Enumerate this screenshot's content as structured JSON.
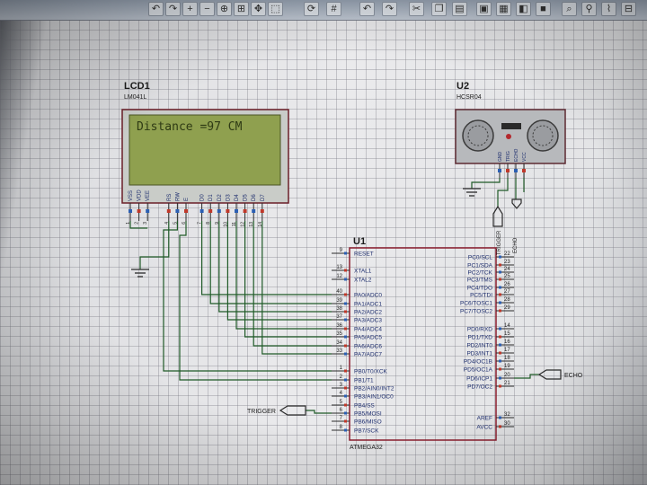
{
  "lcd": {
    "ref": "LCD1",
    "part": "LM041L",
    "display_text": "Distance =97 CM",
    "pin_names": [
      "VSS",
      "VDD",
      "VEE",
      "RS",
      "RW",
      "E",
      "D0",
      "D1",
      "D2",
      "D3",
      "D4",
      "D5",
      "D6",
      "D7"
    ],
    "pin_numbers": [
      "1",
      "2",
      "3",
      "4",
      "5",
      "6",
      "7",
      "8",
      "9",
      "10",
      "11",
      "12",
      "13",
      "14"
    ]
  },
  "sensor": {
    "ref": "U2",
    "part": "HCSR04",
    "pin_names": [
      "GND",
      "TRIG",
      "ECHO",
      "VCC"
    ]
  },
  "mcu": {
    "ref": "U1",
    "part": "ATMEGA32",
    "left_pins": [
      {
        "num": "9",
        "name": "RESET"
      },
      {
        "num": "13",
        "name": "XTAL1"
      },
      {
        "num": "12",
        "name": "XTAL2"
      },
      {
        "num": "40",
        "name": "PA0/ADC0"
      },
      {
        "num": "39",
        "name": "PA1/ADC1"
      },
      {
        "num": "38",
        "name": "PA2/ADC2"
      },
      {
        "num": "37",
        "name": "PA3/ADC3"
      },
      {
        "num": "36",
        "name": "PA4/ADC4"
      },
      {
        "num": "35",
        "name": "PA5/ADC5"
      },
      {
        "num": "34",
        "name": "PA6/ADC6"
      },
      {
        "num": "33",
        "name": "PA7/ADC7"
      },
      {
        "num": "1",
        "name": "PB0/T0/XCK"
      },
      {
        "num": "2",
        "name": "PB1/T1"
      },
      {
        "num": "3",
        "name": "PB2/AIN0/INT2"
      },
      {
        "num": "4",
        "name": "PB3/AIN1/OC0"
      },
      {
        "num": "5",
        "name": "PB4/SS"
      },
      {
        "num": "6",
        "name": "PB5/MOSI"
      },
      {
        "num": "7",
        "name": "PB6/MISO"
      },
      {
        "num": "8",
        "name": "PB7/SCK"
      }
    ],
    "right_pins": [
      {
        "num": "22",
        "name": "PC0/SCL"
      },
      {
        "num": "23",
        "name": "PC1/SDA"
      },
      {
        "num": "24",
        "name": "PC2/TCK"
      },
      {
        "num": "25",
        "name": "PC3/TMS"
      },
      {
        "num": "26",
        "name": "PC4/TDO"
      },
      {
        "num": "27",
        "name": "PC5/TDI"
      },
      {
        "num": "28",
        "name": "PC6/TOSC1"
      },
      {
        "num": "29",
        "name": "PC7/TOSC2"
      },
      {
        "num": "14",
        "name": "PD0/RXD"
      },
      {
        "num": "15",
        "name": "PD1/TXD"
      },
      {
        "num": "16",
        "name": "PD2/INT0"
      },
      {
        "num": "17",
        "name": "PD3/INT1"
      },
      {
        "num": "18",
        "name": "PD4/OC1B"
      },
      {
        "num": "19",
        "name": "PD5/OC1A"
      },
      {
        "num": "20",
        "name": "PD6/ICP1"
      },
      {
        "num": "21",
        "name": "PD7/OC2"
      },
      {
        "num": "32",
        "name": "AREF"
      },
      {
        "num": "30",
        "name": "AVCC"
      }
    ]
  },
  "terminals": {
    "trigger": "TRIGGER",
    "echo": "ECHO",
    "sensor_trigger": "TRIGGER",
    "sensor_echo": "ECHO"
  },
  "toolbar": {
    "icons": [
      "undo-icon",
      "redo-icon",
      "cut-icon",
      "copy-icon",
      "paste-icon",
      "block-copy-icon",
      "block-move-icon",
      "block-rotate-icon",
      "block-delete-icon",
      "zoom-icon",
      "search-icon",
      "wire-autorouter-icon",
      "design-explorer-icon"
    ]
  },
  "colors": {
    "wire": "#1f5a27",
    "component_border": "#8b1e2e",
    "lcd_screen": "#8fa04f",
    "lcd_text": "#2e3a14",
    "pin_label": "#1e2e6e",
    "terminal": "#2a2a2a"
  }
}
